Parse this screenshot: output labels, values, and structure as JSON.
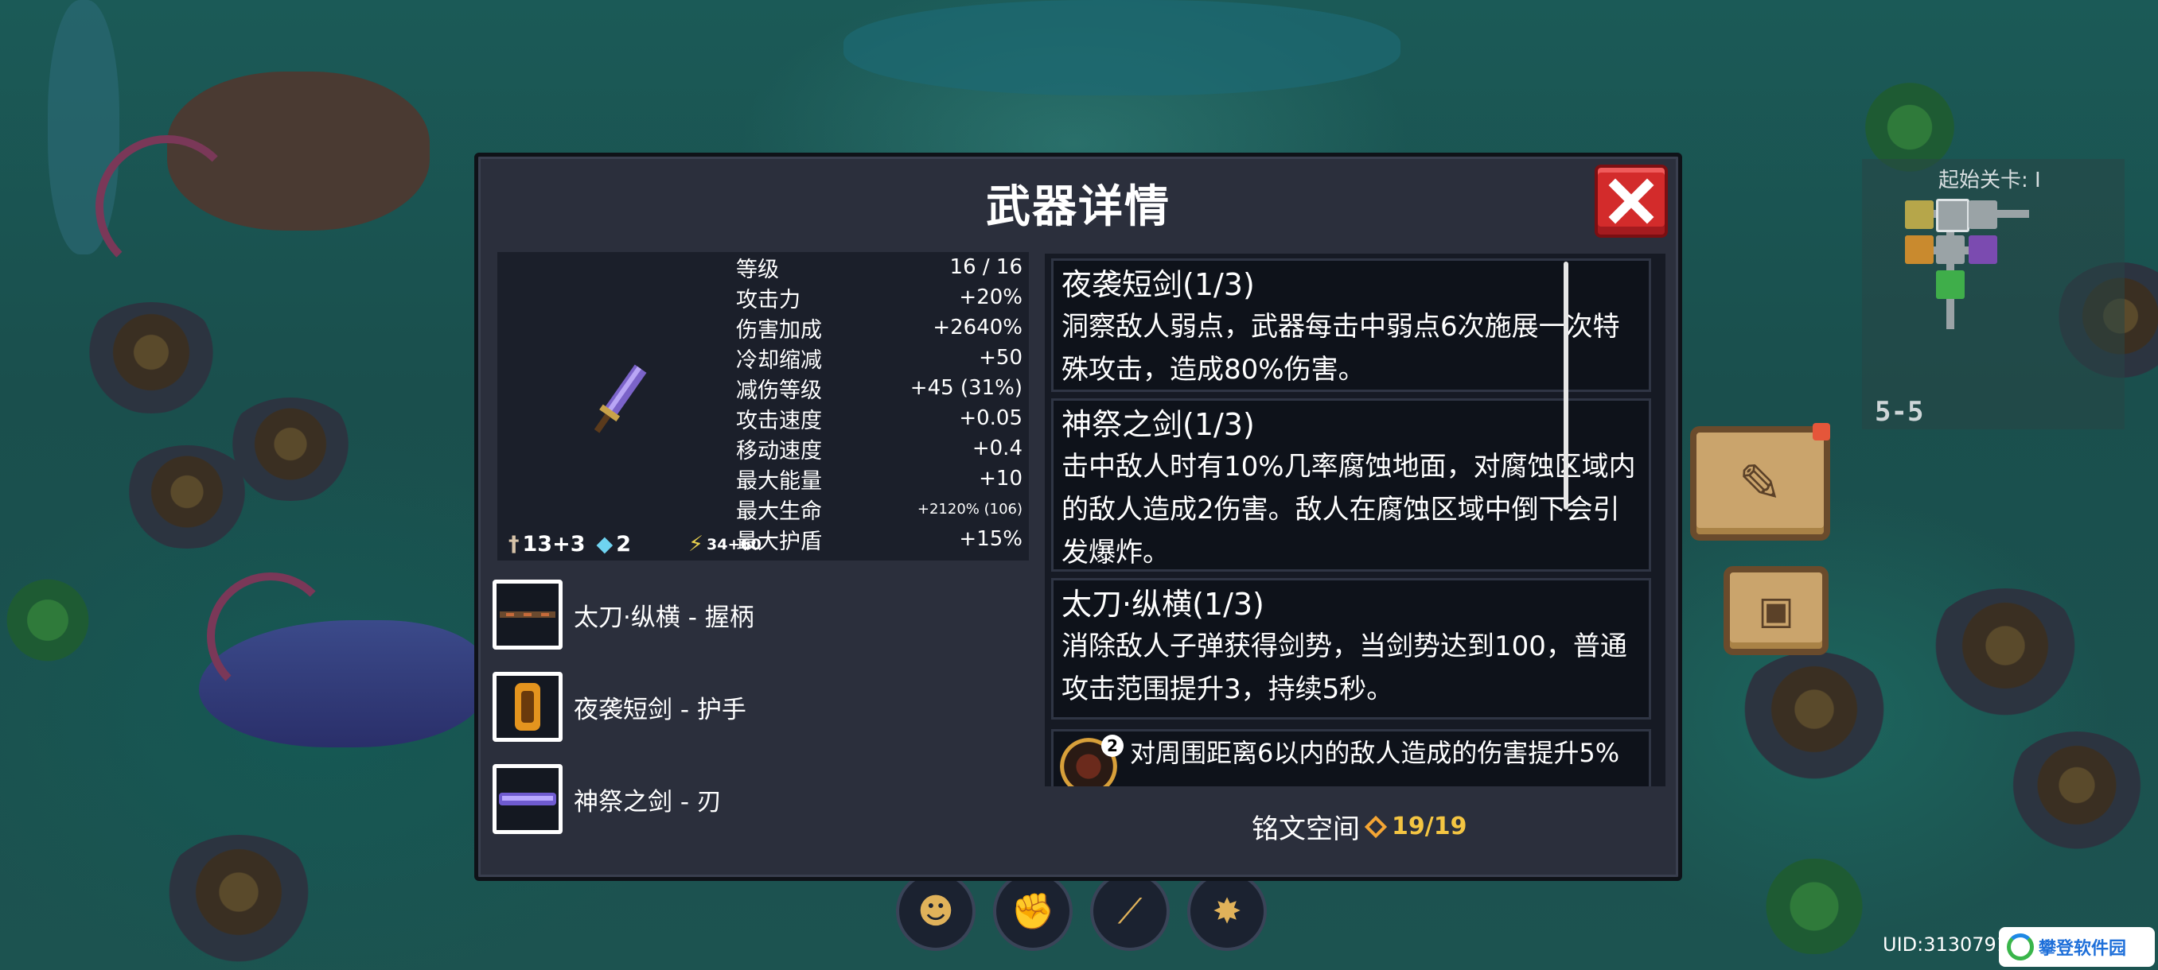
{
  "modal": {
    "title": "武器详情",
    "close_icon": "close-x-icon"
  },
  "weapon": {
    "sprite_icon": "purple-sword-icon",
    "stats": [
      {
        "label": "等级",
        "value": "16 / 16"
      },
      {
        "label": "攻击力",
        "value": "+20%"
      },
      {
        "label": "伤害加成",
        "value": "+2640%"
      },
      {
        "label": "冷却缩减",
        "value": "+50"
      },
      {
        "label": "减伤等级",
        "value": "+45 (31%)"
      },
      {
        "label": "攻击速度",
        "value": "+0.05"
      },
      {
        "label": "移动速度",
        "value": "+0.4"
      },
      {
        "label": "最大能量",
        "value": "+10"
      },
      {
        "label": "最大生命",
        "value": "+2120% (106)"
      },
      {
        "label": "最大护盾",
        "value": "+15%"
      }
    ],
    "bottom": {
      "attack": "13+3",
      "crystal": "2",
      "energy": "34+60"
    }
  },
  "parts": [
    {
      "label": "太刀·纵横 - 握柄",
      "icon": "katana-grip-icon"
    },
    {
      "label": "夜袭短剑 - 护手",
      "icon": "gold-guard-icon"
    },
    {
      "label": "神祭之剑 - 刃",
      "icon": "purple-blade-icon"
    }
  ],
  "descriptions": [
    {
      "title": "夜袭短剑(1/3)",
      "body": "洞察敌人弱点，武器每击中弱点6次施展一次特殊攻击，造成80%伤害。"
    },
    {
      "title": "神祭之剑(1/3)",
      "body": "击中敌人时有10%几率腐蚀地面，对腐蚀区域内的敌人造成2伤害。敌人在腐蚀区域中倒下会引发爆炸。"
    },
    {
      "title": "太刀·纵横(1/3)",
      "body": "消除敌人子弹获得剑势，当剑势达到100，普通攻击范围提升3，持续5秒。"
    }
  ],
  "rune": {
    "badge": "2",
    "text": "对周围距离6以内的敌人造成的伤害提升5%"
  },
  "rune_space": {
    "label": "铭文空间",
    "value": "19/19"
  },
  "minimap": {
    "start_label": "起始关卡: I",
    "stage": "5-5"
  },
  "hud": {
    "uid": "UID:3130791",
    "watermark": "攀登软件园",
    "notes_icon": "notebook-pencil-icon",
    "profile_icon": "profile-card-icon"
  }
}
